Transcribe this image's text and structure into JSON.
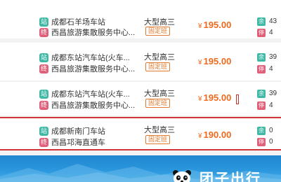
{
  "tags": {
    "depart": "站",
    "arrive": "终",
    "remain": "余",
    "stops": "停"
  },
  "currency": "¥",
  "schedules": [
    {
      "from": "成都石羊场车站",
      "to": "西昌旅游集散服务中心...",
      "bus_type": "大型高三",
      "fixed": "固定班",
      "price": "195.00",
      "remain": "43",
      "stops": "4"
    },
    {
      "from": "成都东站汽车站(火车...",
      "to": "西昌旅游集散服务中心...",
      "bus_type": "大型高三",
      "fixed": "固定班",
      "price": "195.00",
      "remain": "39",
      "stops": "4"
    },
    {
      "from": "成都东站汽车站(火车...",
      "to": "西昌旅游集散服务中心...",
      "bus_type": "大型高三",
      "fixed": "固定班",
      "price": "195.00",
      "remain": "39",
      "stops": "4"
    },
    {
      "from": "成都新南门车站",
      "to": "西昌邛海直通车",
      "bus_type": "大型高三",
      "fixed": "固定班",
      "price": "190.00",
      "remain": "0",
      "stops": "0"
    }
  ],
  "banner": {
    "brand": "团子出行"
  },
  "colors": {
    "accent": "#f06a1d",
    "selected_border": "#d0333a",
    "banner": "#2c98de"
  },
  "icons": {
    "panda": "panda-logo-icon"
  }
}
